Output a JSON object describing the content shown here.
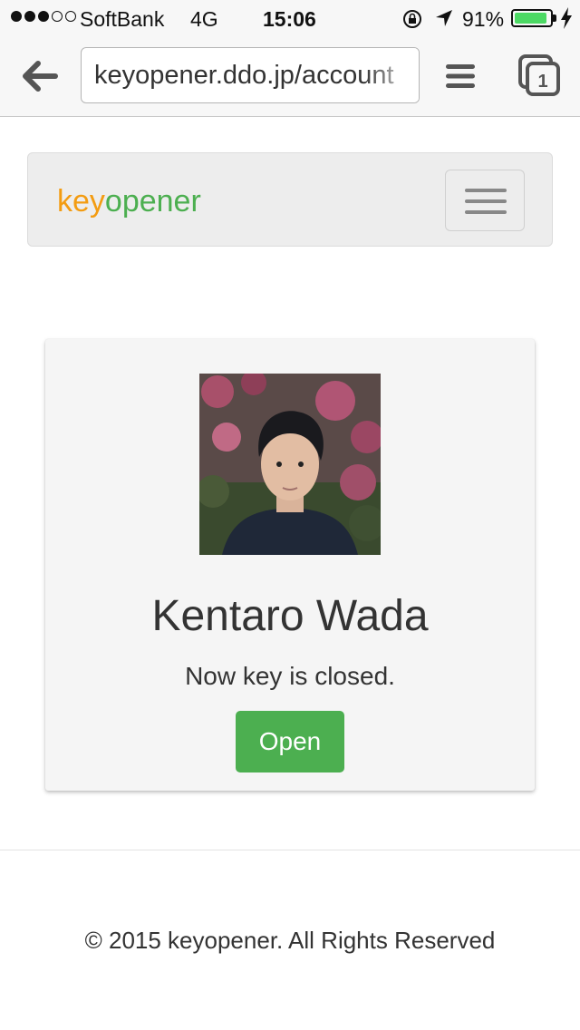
{
  "status_bar": {
    "signal_filled": 3,
    "signal_total": 5,
    "carrier": "SoftBank",
    "network": "4G",
    "time": "15:06",
    "battery_percent_text": "91%",
    "battery_level": 0.91,
    "icons": [
      "rotation-lock-icon",
      "location-arrow-icon",
      "battery-icon",
      "charging-bolt-icon"
    ]
  },
  "browser": {
    "url": "keyopener.ddo.jp/account",
    "tab_count": "1",
    "icons": [
      "back-arrow-icon",
      "menu-icon",
      "tabs-icon"
    ]
  },
  "navbar": {
    "brand_part1": "key",
    "brand_part2": "opener",
    "brand_colors": {
      "key": "#f39c12",
      "opener": "#4caf50"
    },
    "toggle_icon": "hamburger-icon"
  },
  "profile": {
    "name": "Kentaro Wada",
    "status_text": "Now key is closed.",
    "open_button_label": "Open",
    "button_color": "#4caf50"
  },
  "footer": {
    "copyright": "© 2015 keyopener. All Rights Reserved"
  }
}
